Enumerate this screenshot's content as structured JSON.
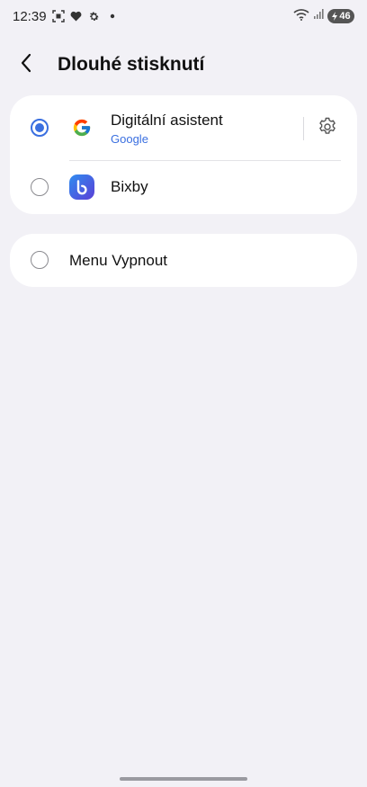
{
  "status_bar": {
    "time": "12:39",
    "battery": "46",
    "left_icons": [
      "screenshot-icon",
      "heart-icon",
      "settings-small-icon",
      "dot-icon"
    ],
    "right_icons": [
      "wifi-icon",
      "signal-icon",
      "battery-icon"
    ]
  },
  "header": {
    "title": "Dlouhé stisknutí"
  },
  "options": {
    "google": {
      "label": "Digitální asistent",
      "sublabel": "Google",
      "selected": true
    },
    "bixby": {
      "label": "Bixby",
      "selected": false
    },
    "power_menu": {
      "label": "Menu Vypnout",
      "selected": false
    }
  },
  "colors": {
    "accent": "#3a6fe0",
    "background": "#f2f1f6",
    "card": "#ffffff"
  }
}
